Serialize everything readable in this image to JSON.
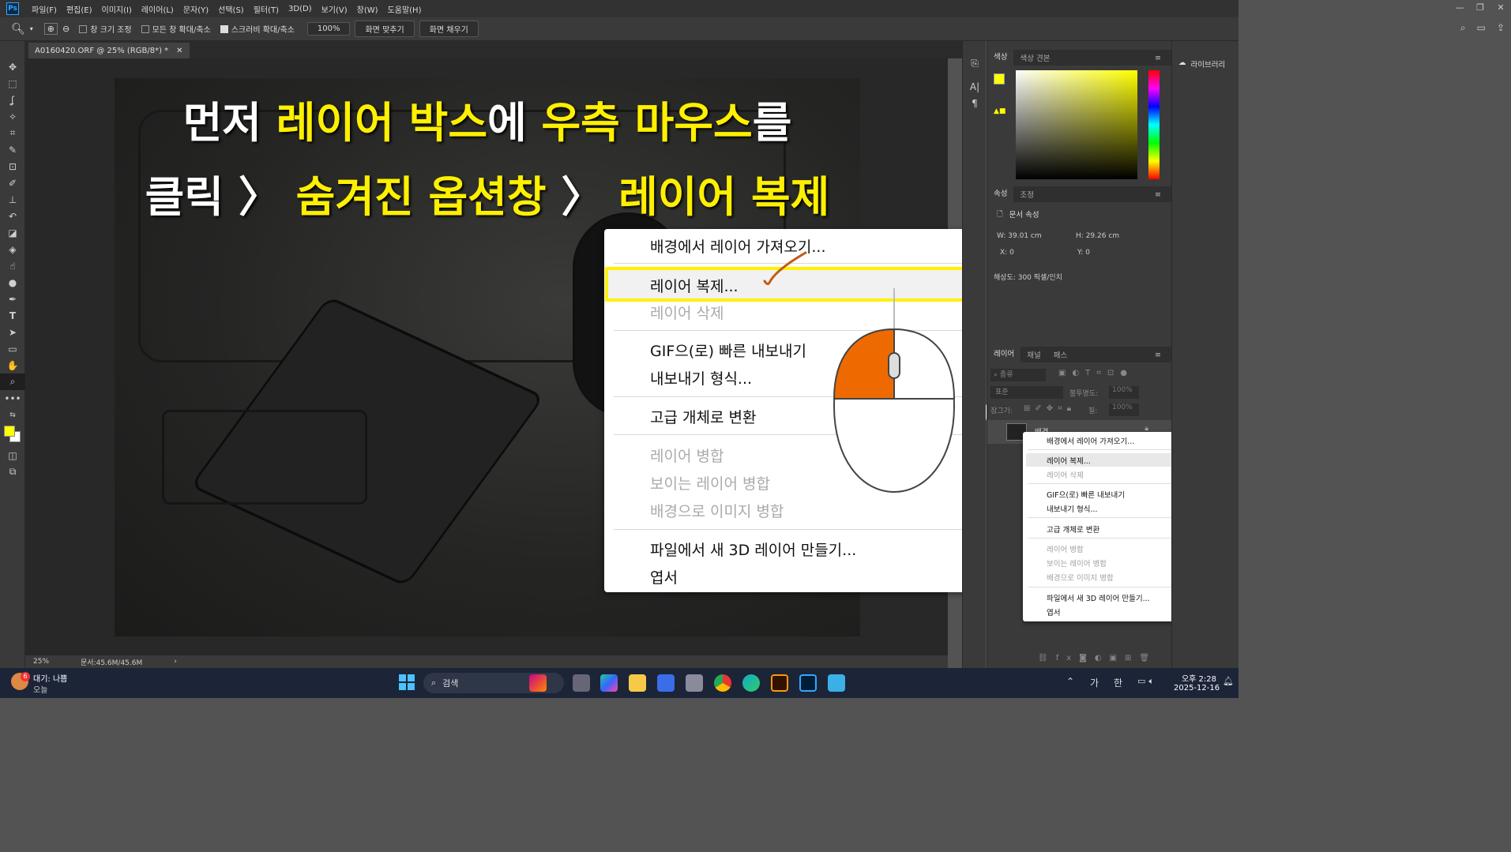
{
  "menubar": {
    "items": [
      "파일(F)",
      "편집(E)",
      "이미지(I)",
      "레이어(L)",
      "문자(Y)",
      "선택(S)",
      "필터(T)",
      "3D(D)",
      "보기(V)",
      "창(W)",
      "도움말(H)"
    ]
  },
  "optbar": {
    "resize_windows": "창 크기 조정",
    "zoom_all": "모든 창 확대/축소",
    "scrubby_zoom": "스크러비 확대/축소",
    "zoom_value": "100%",
    "fit_screen": "화면 맞추기",
    "fill_screen": "화면 채우기"
  },
  "document": {
    "tab_title": "A0160420.ORF @ 25% (RGB/8*) *",
    "zoom": "25%",
    "doc_size": "문서:45.6M/45.6M"
  },
  "headline": {
    "line1_a": "먼저 ",
    "line1_b": "레이어 박스",
    "line1_c": "에 ",
    "line1_d": "우측 마우스",
    "line1_e": "를",
    "line2_a": "클릭 〉 ",
    "line2_b": "숨겨진 옵션창",
    "line2_c": " 〉 ",
    "line2_d": "레이어 복제"
  },
  "big_menu": {
    "items": [
      "배경에서 레이어 가져오기...",
      "레이어 복제...",
      "레이어 삭제",
      "GIF으(로) 빠른 내보내기",
      "내보내기 형식...",
      "고급 개체로 변환",
      "레이어 병합",
      "보이는 레이어 병합",
      "배경으로 이미지 병합",
      "파일에서 새 3D 레이어 만들기...",
      "엽서"
    ]
  },
  "small_menu": {
    "items": [
      "배경에서 레이어 가져오기...",
      "레이어 복제...",
      "레이어 삭제",
      "GIF으(로) 빠른 내보내기",
      "내보내기 형식...",
      "고급 개체로 변환",
      "레이어 병합",
      "보이는 레이어 병합",
      "배경으로 이미지 병합",
      "파일에서 새 3D 레이어 만들기...",
      "엽서"
    ]
  },
  "color_panel": {
    "tab_color": "색상",
    "tab_swatches": "색상 견본",
    "fg_color": "#ffff00"
  },
  "properties": {
    "tab_props": "속성",
    "tab_adjust": "조정",
    "doc_props": "문서 속성",
    "w_label": "W:",
    "w": "39.01 cm",
    "h_label": "H:",
    "h": "29.26 cm",
    "x_label": "X:",
    "x": "0",
    "y_label": "Y:",
    "y": "0",
    "resolution": "해상도: 300 픽셀/인치"
  },
  "layers": {
    "tab_layers": "레이어",
    "tab_channels": "채널",
    "tab_paths": "패스",
    "kind": "종류",
    "blend": "표준",
    "opacity_label": "불투명도:",
    "opacity": "100%",
    "lock_label": "잠그기:",
    "fill_label": "칠:",
    "fill": "100%",
    "layer_name": "배경"
  },
  "libraries": {
    "label": "라이브러리"
  },
  "taskbar": {
    "weather_temp": "6",
    "weather_text": "대기: 나쁨",
    "weather_sub": "오늘",
    "search": "검색",
    "ime_a": "가",
    "ime_b": "한",
    "time": "오후 2:28",
    "date": "2025-12-16"
  }
}
